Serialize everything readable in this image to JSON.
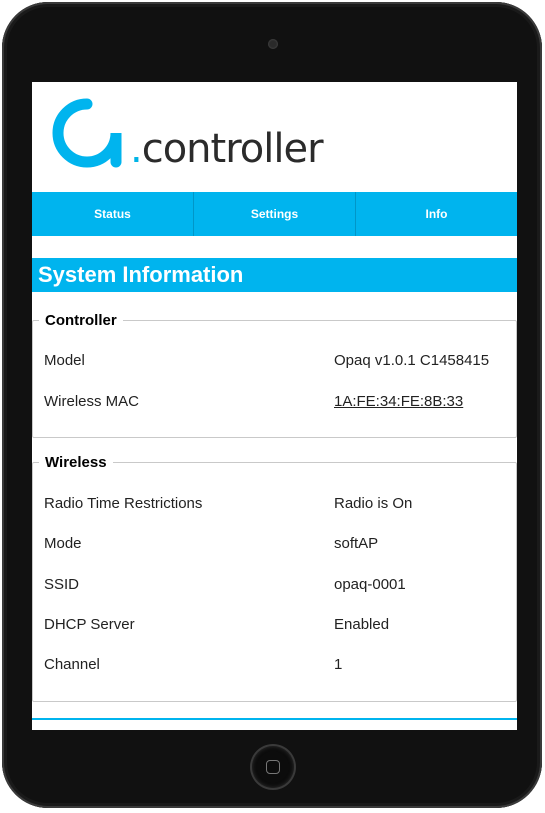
{
  "brand": {
    "logo_text_dot": ".",
    "logo_text": "controller",
    "accent": "#00b4ee"
  },
  "nav": {
    "items": [
      {
        "label": "Status"
      },
      {
        "label": "Settings"
      },
      {
        "label": "Info"
      }
    ]
  },
  "page": {
    "title": "System Information"
  },
  "controller": {
    "legend": "Controller",
    "rows": [
      {
        "label": "Model",
        "value": "Opaq v1.0.1 C1458415"
      },
      {
        "label": "Wireless MAC",
        "value": "1A:FE:34:FE:8B:33"
      }
    ]
  },
  "wireless": {
    "legend": "Wireless",
    "rows": [
      {
        "label": "Radio Time Restrictions",
        "value": "Radio is On"
      },
      {
        "label": "Mode",
        "value": "softAP"
      },
      {
        "label": "SSID",
        "value": "opaq-0001"
      },
      {
        "label": "DHCP Server",
        "value": "Enabled"
      },
      {
        "label": "Channel",
        "value": "1"
      }
    ]
  }
}
